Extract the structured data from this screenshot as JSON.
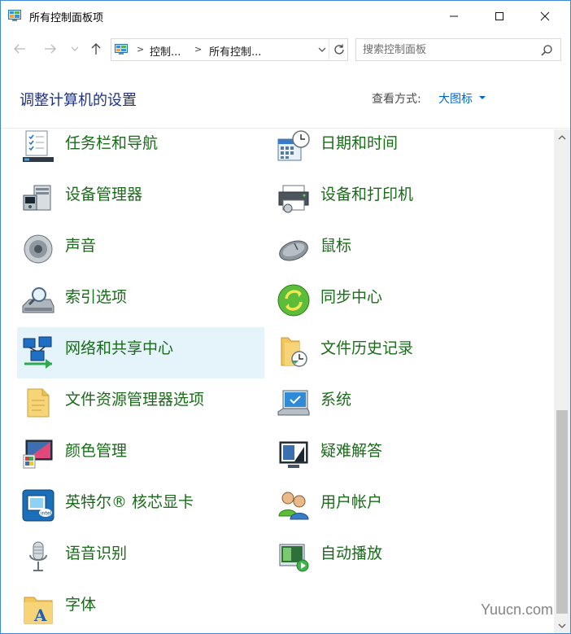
{
  "window": {
    "title": "所有控制面板项",
    "accent_color": "#3c8ad6"
  },
  "address": {
    "crumb1": "控制...",
    "crumb2": "所有控制...",
    "separator": ">"
  },
  "search": {
    "placeholder": "搜索控制面板"
  },
  "header": {
    "title": "调整计算机的设置",
    "view_by_label": "查看方式:",
    "view_by_value": "大图标"
  },
  "items": {
    "left": [
      {
        "label": "任务栏和导航",
        "icon": "taskbar-icon"
      },
      {
        "label": "设备管理器",
        "icon": "device-manager-icon"
      },
      {
        "label": "声音",
        "icon": "speaker-icon"
      },
      {
        "label": "索引选项",
        "icon": "indexing-icon"
      },
      {
        "label": "网络和共享中心",
        "icon": "network-icon"
      },
      {
        "label": "文件资源管理器选项",
        "icon": "folder-options-icon"
      },
      {
        "label": "颜色管理",
        "icon": "color-management-icon"
      },
      {
        "label": "英特尔® 核芯显卡",
        "icon": "intel-graphics-icon"
      },
      {
        "label": "语音识别",
        "icon": "microphone-icon"
      },
      {
        "label": "字体",
        "icon": "fonts-icon"
      }
    ],
    "right": [
      {
        "label": "日期和时间",
        "icon": "calendar-clock-icon"
      },
      {
        "label": "设备和打印机",
        "icon": "printer-icon"
      },
      {
        "label": "鼠标",
        "icon": "mouse-icon"
      },
      {
        "label": "同步中心",
        "icon": "sync-icon"
      },
      {
        "label": "文件历史记录",
        "icon": "file-history-icon"
      },
      {
        "label": "系统",
        "icon": "system-icon"
      },
      {
        "label": "疑难解答",
        "icon": "troubleshooting-icon"
      },
      {
        "label": "用户帐户",
        "icon": "user-accounts-icon"
      },
      {
        "label": "自动播放",
        "icon": "autoplay-icon"
      }
    ]
  },
  "colors": {
    "item_label": "#1a6b1a",
    "title": "#1e3287",
    "link": "#0066cc",
    "hover_bg": "#e5f3fb"
  },
  "watermark": "Yuucn.com"
}
